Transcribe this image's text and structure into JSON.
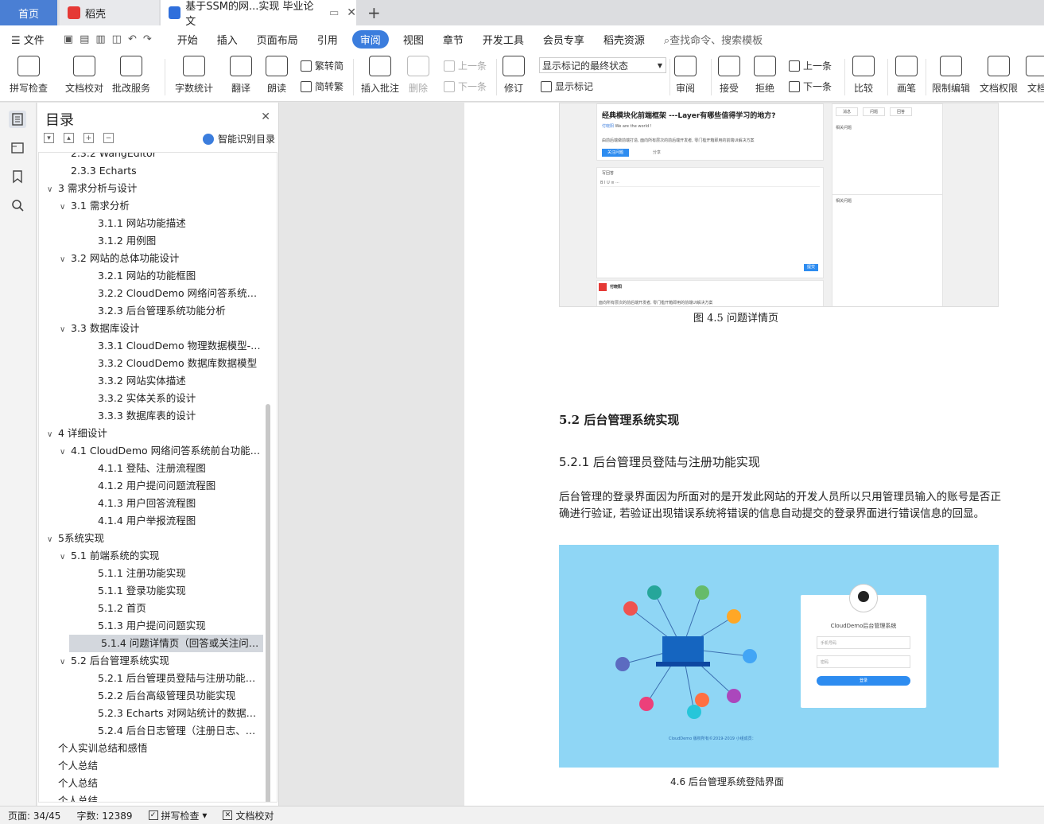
{
  "tabs": {
    "home": "首页",
    "daoke": "稻壳",
    "doc": "基于SSM的网...实现 毕业论文"
  },
  "menu": {
    "file": "文件",
    "items": [
      "开始",
      "插入",
      "页面布局",
      "引用",
      "审阅",
      "视图",
      "章节",
      "开发工具",
      "会员专享",
      "稻壳资源"
    ],
    "active": "审阅",
    "search": "查找命令、搜索模板"
  },
  "ribbon": {
    "spell": "拼写检查",
    "proof": "文档校对",
    "batch": "批改服务",
    "count": "字数统计",
    "translate": "翻译",
    "read": "朗读",
    "trad": "繁转简",
    "simp": "简转繁",
    "insert_comment": "插入批注",
    "delete": "删除",
    "prev_comment": "上一条",
    "next_comment": "下一条",
    "track": "修订",
    "markup_state": "显示标记的最终状态",
    "show_markup": "显示标记",
    "review": "审阅",
    "accept": "接受",
    "reject": "拒绝",
    "prev_change": "上一条",
    "next_change": "下一条",
    "compare": "比较",
    "pen": "画笔",
    "restrict": "限制编辑",
    "perm": "文档权限",
    "more": "文档"
  },
  "toc": {
    "title": "目录",
    "smart": "智能识别目录",
    "items": [
      {
        "t": "2.3.2 WangEditor",
        "l": 2,
        "c": false
      },
      {
        "t": "2.3.3 Echarts",
        "l": 2,
        "c": false
      },
      {
        "t": "3  需求分析与设计",
        "l": 1,
        "c": true
      },
      {
        "t": "3.1 需求分析",
        "l": 2,
        "c": true
      },
      {
        "t": "3.1.1  网站功能描述",
        "l": 3,
        "c": false
      },
      {
        "t": "3.1.2  用例图",
        "l": 3,
        "c": false
      },
      {
        "t": "3.2  网站的总体功能设计",
        "l": 2,
        "c": true
      },
      {
        "t": "3.2.1 网站的功能框图",
        "l": 3,
        "c": false
      },
      {
        "t": "3.2.2 CloudDemo 网络问答系统前台功能分析",
        "l": 3,
        "c": false
      },
      {
        "t": "3.2.3 后台管理系统功能分析",
        "l": 3,
        "c": false
      },
      {
        "t": "3.3 数据库设计",
        "l": 2,
        "c": true
      },
      {
        "t": "3.3.1 CloudDemo 物理数据模型-PhysicalDataModel",
        "l": 3,
        "c": false
      },
      {
        "t": "3.3.2 CloudDemo 数据库数据模型",
        "l": 3,
        "c": false
      },
      {
        "t": "3.3.2  网站实体描述",
        "l": 3,
        "c": false
      },
      {
        "t": "3.3.2  实体关系的设计",
        "l": 3,
        "c": false
      },
      {
        "t": "3.3.3  数据库表的设计",
        "l": 3,
        "c": false
      },
      {
        "t": "4  详细设计",
        "l": 1,
        "c": true
      },
      {
        "t": "4.1 CloudDemo 网络问答系统前台功能流程图",
        "l": 2,
        "c": true
      },
      {
        "t": "4.1.1  登陆、注册流程图",
        "l": 3,
        "c": false
      },
      {
        "t": "4.1.2  用户提问问题流程图",
        "l": 3,
        "c": false
      },
      {
        "t": "4.1.3  用户回答流程图",
        "l": 3,
        "c": false
      },
      {
        "t": "4.1.4  用户举报流程图",
        "l": 3,
        "c": false
      },
      {
        "t": "5系统实现",
        "l": 1,
        "c": true
      },
      {
        "t": "5.1  前端系统的实现",
        "l": 2,
        "c": true
      },
      {
        "t": "5.1.1 注册功能实现",
        "l": 3,
        "c": false
      },
      {
        "t": "5.1.1 登录功能实现",
        "l": 3,
        "c": false
      },
      {
        "t": "5.1.2  首页",
        "l": 3,
        "c": false
      },
      {
        "t": "5.1.3  用户提问问题实现",
        "l": 3,
        "c": false
      },
      {
        "t": "5.1.4  问题详情页（回答或关注问题）实现",
        "l": 3,
        "c": false,
        "sel": true
      },
      {
        "t": "5.2  后台管理系统实现",
        "l": 2,
        "c": true
      },
      {
        "t": "5.2.1  后台管理员登陆与注册功能实现",
        "l": 3,
        "c": false
      },
      {
        "t": "5.2.2  后台高级管理员功能实现",
        "l": 3,
        "c": false
      },
      {
        "t": "5.2.3 Echarts 对网站统计的数据动态展示",
        "l": 3,
        "c": false
      },
      {
        "t": "5.2.4  后台日志管理（注册日志、用户登录日志）",
        "l": 3,
        "c": false
      },
      {
        "t": "个人实训总结和感悟",
        "l": 1,
        "c": false
      },
      {
        "t": "个人总结",
        "l": 1,
        "c": false
      },
      {
        "t": "个人总结",
        "l": 1,
        "c": false
      },
      {
        "t": "个人总结",
        "l": 1,
        "c": false
      }
    ]
  },
  "doc": {
    "shot1": {
      "title": "经典模块化前端框架 ---Layer有哪些值得学习的地方?",
      "user": "付晓阳",
      "tag": "We are the world !",
      "desc": "由前后端做前端打造, 面向所有层次的前后端开发者, 零门槛开箱即用的前端UI解决方案",
      "btn": "关注问题",
      "share": "分享",
      "answer": "写回答",
      "submit": "提交",
      "tab1": "消息",
      "tab2": "问题",
      "tab3": "回答",
      "side1": "相关问题",
      "side2": "相关问题",
      "user2": "付晓阳",
      "msg": "面向所有层次的前后端开发者, 零门槛开箱即用的前端UI解决方案"
    },
    "caption1": "图 4.5  问题详情页",
    "h2": "5.2  后台管理系统实现",
    "h3": "5.2.1  后台管理员登陆与注册功能实现",
    "para": "后台管理的登录界面因为所面对的是开发此网站的开发人员所以只用管理员输入的账号是否正确进行验证, 若验证出现错误系统将错误的信息自动提交的登录界面进行错误信息的回显。",
    "login": {
      "title": "CloudDemo后台管理系统",
      "user_ph": "手机号码",
      "pwd_ph": "密码",
      "btn": "登录",
      "footer": "CloudDemo 版权所有©2019-2019 小组成员："
    },
    "caption2": "4.6  后台管理系统登陆界面"
  },
  "status": {
    "page": "页面: 34/45",
    "words": "字数: 12389",
    "spell": "拼写检查",
    "proof": "文档校对"
  },
  "colors": {
    "accent": "#3b7ddd",
    "login_bg": "#8fd6f5"
  }
}
